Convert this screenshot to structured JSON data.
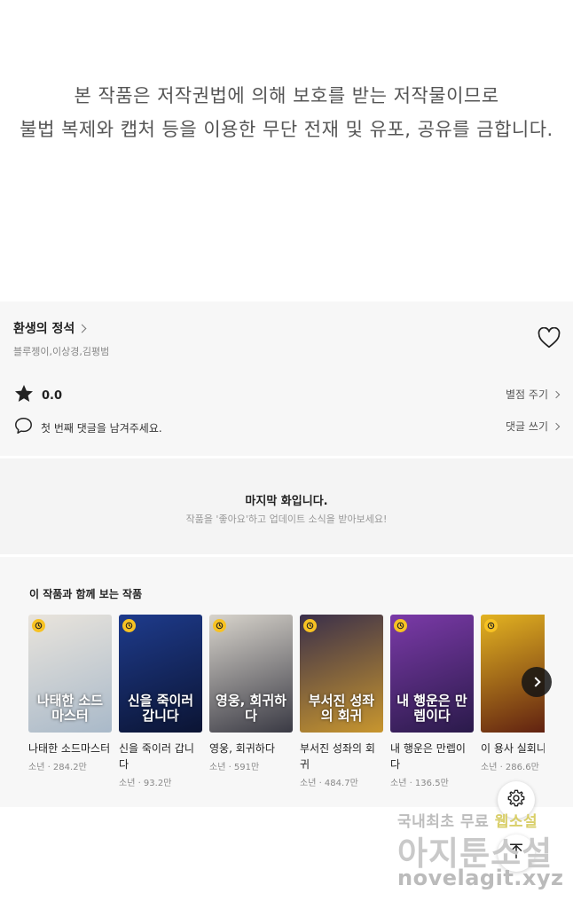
{
  "notice": {
    "line1": "본 작품은 저작권법에 의해 보호를 받는 저작물이므로",
    "line2": "불법 복제와 캡처 등을 이용한 무단 전재 및 유포, 공유를 금합니다."
  },
  "work": {
    "title": "환생의 정석",
    "authors": "블루젱이,이상경,김평범",
    "favorite_icon": "heart-outline-icon"
  },
  "rating": {
    "icon": "star-icon",
    "value": "0.0",
    "link_label": "별점 주기"
  },
  "comments": {
    "icon": "speech-bubble-icon",
    "prompt": "첫 번째 댓글을 남겨주세요.",
    "link_label": "댓글 쓰기"
  },
  "last_episode": {
    "title": "마지막 화입니다.",
    "subtitle": "작품을 '좋아요'하고 업데이트 소식을 받아보세요!"
  },
  "recommendations": {
    "title": "이 작품과 함께 보는 작품",
    "items": [
      {
        "name": "나태한 소드마스터",
        "meta": "소년 · 284.2만",
        "cover_text": "나태한 소드마스터",
        "colors": [
          "#e9e4dc",
          "#a9b9c9"
        ]
      },
      {
        "name": "신을 죽이러 갑니다",
        "meta": "소년 · 93.2만",
        "cover_text": "신을 죽이러 갑니다",
        "colors": [
          "#1e3b8c",
          "#0b1433"
        ]
      },
      {
        "name": "영웅, 회귀하다",
        "meta": "소년 · 591만",
        "cover_text": "영웅, 회귀하다",
        "colors": [
          "#d8d4cc",
          "#3a3a44"
        ]
      },
      {
        "name": "부서진 성좌의 회귀",
        "meta": "소년 · 484.7만",
        "cover_text": "부서진 성좌의 회귀",
        "colors": [
          "#3a2f4a",
          "#c8962e"
        ]
      },
      {
        "name": "내 행운은 만렙이다",
        "meta": "소년 · 136.5만",
        "cover_text": "내 행운은 만렙이다",
        "colors": [
          "#7b3aa8",
          "#2a1a4a"
        ]
      },
      {
        "name": "이 용사 실회니",
        "meta": "소년 · 286.6만",
        "cover_text": "",
        "colors": [
          "#e3b321",
          "#5a1a10"
        ]
      }
    ],
    "next_icon": "chevron-right-icon",
    "badge_icon": "clock-icon"
  },
  "floating": {
    "settings_icon": "gear-icon",
    "top_icon": "arrow-up-icon"
  },
  "watermark": {
    "line1_a": "국내최초 무료 ",
    "line1_b": "웹소설",
    "line2": "아지툰소설",
    "line3": "novelagit.xyz"
  }
}
